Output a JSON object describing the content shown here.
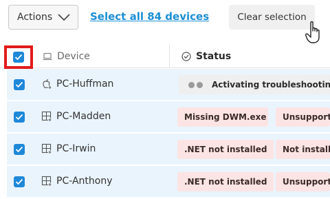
{
  "toolbar": {
    "actions_label": "Actions",
    "select_all_label": "Select all 84 devices",
    "clear_label": "Clear selection"
  },
  "table": {
    "columns": {
      "device": "Device",
      "status": "Status"
    },
    "rows": [
      {
        "name": "PC-Huffman",
        "os_icon": "apple-icon",
        "statuses": [
          "Activating troubleshooting"
        ]
      },
      {
        "name": "PC-Madden",
        "os_icon": "windows-icon",
        "statuses": [
          "Missing DWM.exe",
          "Unsupported"
        ]
      },
      {
        "name": "PC-Irwin",
        "os_icon": "windows-icon",
        "statuses": [
          ".NET not installed",
          "Not installed"
        ]
      },
      {
        "name": "PC-Anthony",
        "os_icon": "windows-icon",
        "statuses": [
          ".NET not installed",
          "Unsupported"
        ]
      }
    ]
  },
  "colors": {
    "accent": "#1e88d9",
    "link": "#1b8fd4",
    "row_selected": "#eaf4fc",
    "error_pill": "#fde4e4",
    "highlight_frame": "#e11b1b"
  }
}
